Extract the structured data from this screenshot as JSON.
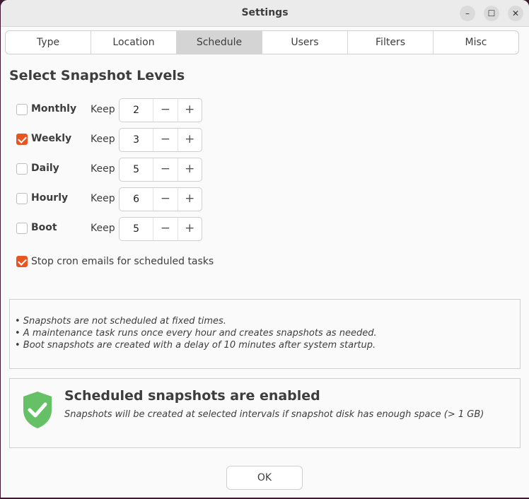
{
  "window": {
    "title": "Settings",
    "controls": {
      "minimize": "–",
      "maximize": "☐",
      "close": "✕"
    }
  },
  "tabs": [
    {
      "label": "Type",
      "active": false
    },
    {
      "label": "Location",
      "active": false
    },
    {
      "label": "Schedule",
      "active": true
    },
    {
      "label": "Users",
      "active": false
    },
    {
      "label": "Filters",
      "active": false
    },
    {
      "label": "Misc",
      "active": false
    }
  ],
  "schedule": {
    "section_title": "Select Snapshot Levels",
    "keep_label": "Keep",
    "minus": "−",
    "plus": "+",
    "levels": [
      {
        "label": "Monthly",
        "checked": false,
        "keep": "2"
      },
      {
        "label": "Weekly",
        "checked": true,
        "keep": "3"
      },
      {
        "label": "Daily",
        "checked": false,
        "keep": "5"
      },
      {
        "label": "Hourly",
        "checked": false,
        "keep": "6"
      },
      {
        "label": "Boot",
        "checked": false,
        "keep": "5"
      }
    ],
    "stop_cron": {
      "label": "Stop cron emails for scheduled tasks",
      "checked": true
    }
  },
  "info": {
    "lines": [
      "• Snapshots are not scheduled at fixed times.",
      "• A maintenance task runs once every hour and creates snapshots as needed.",
      "• Boot snapshots are created with a delay of 10 minutes after system startup."
    ]
  },
  "status": {
    "icon": "shield-check-icon",
    "color": "#5cb85c",
    "title": "Scheduled snapshots are enabled",
    "subtitle": "Snapshots will be created at selected intervals if snapshot disk has enough space (> 1 GB)"
  },
  "footer": {
    "ok_label": "OK"
  },
  "colors": {
    "accent": "#e95420",
    "active_tab": "#d4d4d4"
  }
}
